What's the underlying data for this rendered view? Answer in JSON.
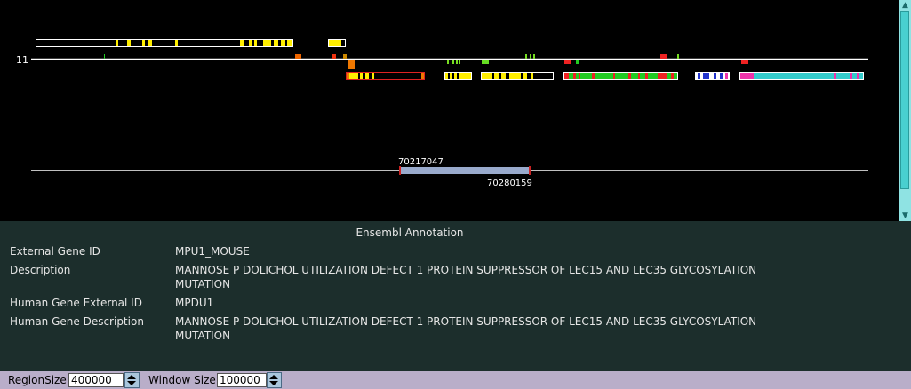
{
  "track": {
    "chromosome_label": "11",
    "range_start_label": "70217047",
    "range_end_label": "70280159"
  },
  "annotation": {
    "header": "Ensembl Annotation",
    "rows": [
      {
        "label": "External Gene ID",
        "value": "MPU1_MOUSE"
      },
      {
        "label": "Description",
        "value": "MANNOSE P DOLICHOL UTILIZATION DEFECT 1 PROTEIN SUPPRESSOR OF LEC15 AND LEC35 GLYCOSYLATION",
        "value_cont": "MUTATION"
      },
      {
        "label": "Human Gene External ID",
        "value": "MPDU1"
      },
      {
        "label": "Human Gene Description",
        "value": "MANNOSE P DOLICHOL UTILIZATION DEFECT 1 PROTEIN SUPPRESSOR OF LEC15 AND LEC35 GLYCOSYLATION",
        "value_cont": "MUTATION"
      }
    ]
  },
  "controls": {
    "region_size_label": "RegionSize",
    "region_size_value": "400000",
    "window_size_label": "Window Size",
    "window_size_value": "100000"
  },
  "colors": {
    "background": "#000000",
    "annotation_bg": "#1c2e2c",
    "bottom_bar": "#b9aec9",
    "gene_yellow": "#ffee00",
    "gene_red": "#e02020",
    "gene_green": "#22cc22",
    "gene_cyan": "#33cccc",
    "gene_magenta": "#ee33aa",
    "selection": "#99aacc"
  }
}
